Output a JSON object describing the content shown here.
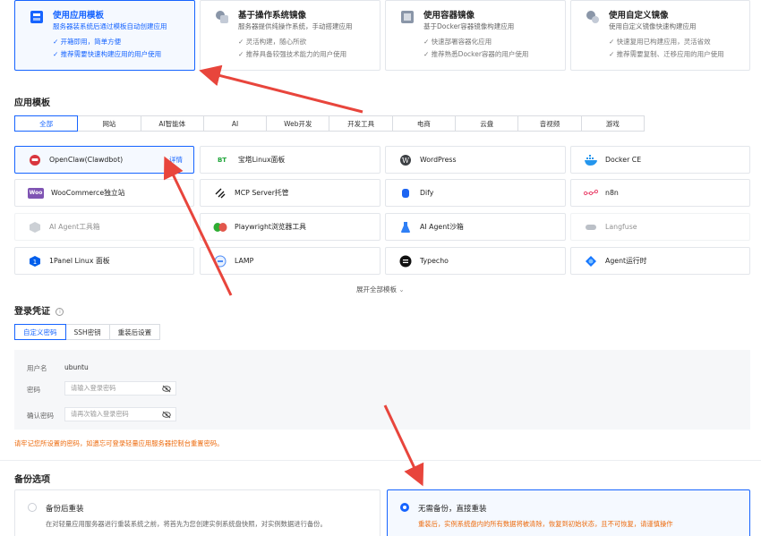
{
  "image_types": [
    {
      "title": "使用应用模板",
      "desc": "服务器装系统后通过模板自动创建应用",
      "features": [
        "开箱即用，简单方便",
        "推荐需要快速构建应用的用户使用"
      ],
      "icon": "app-template-icon"
    },
    {
      "title": "基于操作系统镜像",
      "desc": "服务器提供纯操作系统，手动搭建应用",
      "features": [
        "灵活构建，随心所欲",
        "推荐具备较强技术能力的用户使用"
      ],
      "icon": "os-image-icon"
    },
    {
      "title": "使用容器镜像",
      "desc": "基于Docker容器镜像构建应用",
      "features": [
        "快速部署容器化应用",
        "推荐熟悉Docker容器的用户使用"
      ],
      "icon": "container-image-icon"
    },
    {
      "title": "使用自定义镜像",
      "desc": "使用自定义镜像快速构建应用",
      "features": [
        "快速复用已构建应用，灵活省效",
        "推荐需要复制、迁移应用的用户使用"
      ],
      "icon": "custom-image-icon"
    }
  ],
  "app_template": {
    "section_title": "应用模板",
    "categories": [
      "全部",
      "网站",
      "AI智能体",
      "AI",
      "Web开发",
      "开发工具",
      "电商",
      "云盘",
      "音视频",
      "游戏"
    ],
    "templates": [
      {
        "name": "OpenClaw(Clawdbot)",
        "icon": "openclaw-icon",
        "detail": "详情"
      },
      {
        "name": "宝塔Linux面板",
        "icon": "bt-panel-icon",
        "badge": "BT"
      },
      {
        "name": "WordPress",
        "icon": "wordpress-icon"
      },
      {
        "name": "Docker CE",
        "icon": "docker-icon"
      },
      {
        "name": "WooCommerce独立站",
        "icon": "woocommerce-icon",
        "badge": "Woo"
      },
      {
        "name": "MCP Server托管",
        "icon": "mcp-icon"
      },
      {
        "name": "Dify",
        "icon": "dify-icon"
      },
      {
        "name": "n8n",
        "icon": "n8n-icon"
      },
      {
        "name": "AI Agent工具箱",
        "icon": "ai-toolbox-icon"
      },
      {
        "name": "Playwright浏览器工具",
        "icon": "playwright-icon"
      },
      {
        "name": "AI Agent沙箱",
        "icon": "ai-sandbox-icon"
      },
      {
        "name": "Langfuse",
        "icon": "langfuse-icon"
      },
      {
        "name": "1Panel Linux 面板",
        "icon": "1panel-icon"
      },
      {
        "name": "LAMP",
        "icon": "lamp-icon"
      },
      {
        "name": "Typecho",
        "icon": "typecho-icon",
        "badge": "T"
      },
      {
        "name": "Agent运行时",
        "icon": "agent-runtime-icon"
      }
    ],
    "expand_label": "展开全部模板"
  },
  "login": {
    "section_title": "登录凭证",
    "tabs": [
      "自定义密码",
      "SSH密钥",
      "重装后设置"
    ],
    "username_label": "用户名",
    "username_value": "ubuntu",
    "password_label": "密码",
    "password_placeholder": "请输入登录密码",
    "confirm_label": "确认密码",
    "confirm_placeholder": "请再次输入登录密码",
    "warning": "请牢记您所设置的密码，如遗忘可登录轻量应用服务器控制台重置密码。"
  },
  "backup": {
    "section_title": "备份选项",
    "options": [
      {
        "title": "备份后重装",
        "desc": "在对轻量应用服务器进行重装系统之前，将首先为您创建实例系统盘快照，对实例数据进行备份。"
      },
      {
        "title": "无需备份，直接重装",
        "desc": "重装后，实例系统盘内的所有数据将被清除，恢复到初始状态，且不可恢复，请谨慎操作"
      }
    ]
  },
  "colors": {
    "accent": "#1664ff",
    "warning": "#ed6b0e",
    "arrow": "#e8453c"
  }
}
